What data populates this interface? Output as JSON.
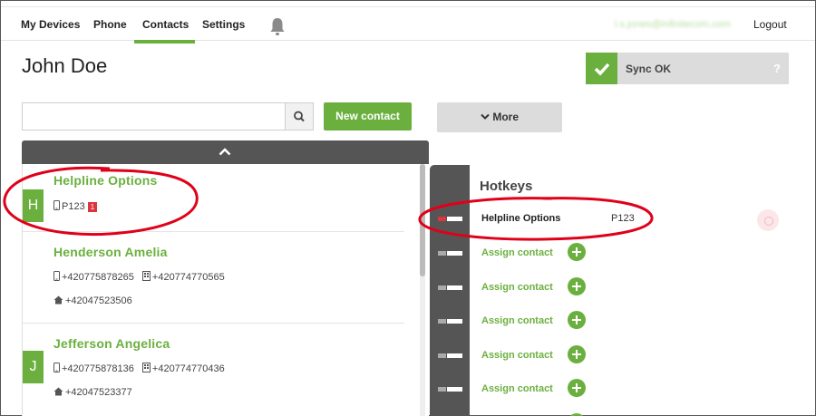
{
  "nav": {
    "items": [
      "My Devices",
      "Phone",
      "Contacts",
      "Settings"
    ],
    "active": "Contacts",
    "user_email": "l.s.jones@infinitecom.com",
    "logout": "Logout"
  },
  "page": {
    "title": "John Doe"
  },
  "sync": {
    "label": "Sync OK",
    "help": "?"
  },
  "toolbar": {
    "search_value": "",
    "new_contact": "New contact",
    "more": "More"
  },
  "contacts": [
    {
      "letter": "H",
      "name": "Helpline Options",
      "mobile": "P123",
      "badge": "1"
    },
    {
      "letter": "",
      "name": "Henderson Amelia",
      "mobile": "+420775878265",
      "office": "+420774770565",
      "home": "+42047523506"
    },
    {
      "letter": "J",
      "name": "Jefferson Angelica",
      "mobile": "+420775878136",
      "office": "+420774770436",
      "home": "+42047523377"
    }
  ],
  "hotkeys": {
    "title": "Hotkeys",
    "assigned": {
      "name": "Helpline Options",
      "code": "P123"
    },
    "assign_label": "Assign contact",
    "assign_slots": 5
  },
  "colors": {
    "accent": "#6bb03f",
    "dark": "#555555",
    "badge": "#d9363e",
    "annotation": "#e0001a"
  }
}
